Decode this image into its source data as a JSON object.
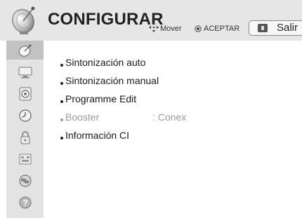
{
  "header": {
    "title": "CONFIGURAR",
    "hint_move": "Mover",
    "hint_ok": "ACEPTAR",
    "exit_label": "Salir",
    "header_icon": "satellite-dish-icon",
    "move_icon": "four-way-arrows-icon",
    "ok_icon": "ok-button-icon",
    "exit_icon": "exit-key-icon"
  },
  "sidebar": {
    "items": [
      {
        "icon": "satellite-dish-icon",
        "active": true
      },
      {
        "icon": "monitor-icon",
        "active": false
      },
      {
        "icon": "speaker-icon",
        "active": false
      },
      {
        "icon": "clock-icon",
        "active": false
      },
      {
        "icon": "lock-icon",
        "active": false
      },
      {
        "icon": "input-panel-icon",
        "active": false
      },
      {
        "icon": "globe-icon",
        "active": false
      },
      {
        "icon": "help-icon",
        "active": false
      }
    ]
  },
  "menu": {
    "items": [
      {
        "label": "Sintonización auto",
        "enabled": true
      },
      {
        "label": "Sintonización manual",
        "enabled": true
      },
      {
        "label": "Programme Edit",
        "enabled": true
      },
      {
        "label": "Booster",
        "value": ": Conex",
        "enabled": false
      },
      {
        "label": "Información CI",
        "enabled": true
      }
    ]
  },
  "colors": {
    "header_bg": "#e6e6e6",
    "sidebar_bg": "#e3e3e3",
    "sidebar_active": "#c2c2c2",
    "text": "#1a1a1a",
    "disabled_text": "#9a9a9a"
  }
}
